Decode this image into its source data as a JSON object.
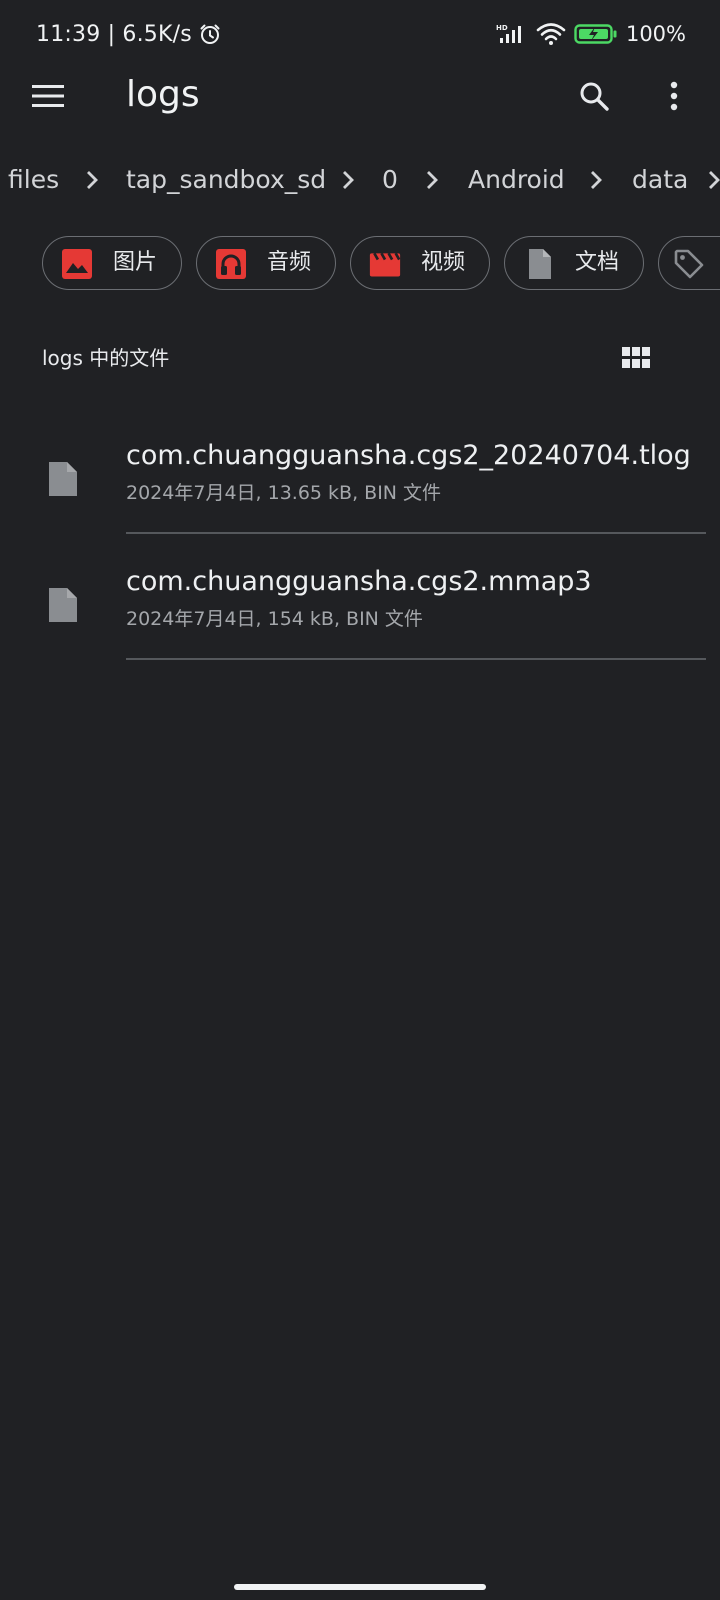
{
  "status_bar": {
    "time_speed": "11:39 | 6.5K/s",
    "battery": "100%",
    "icons": [
      "alarm-icon",
      "hd-signal-icon",
      "wifi-icon",
      "battery-charging-icon"
    ],
    "battery_color": "#4cd964"
  },
  "app_bar": {
    "title": "logs",
    "icons": [
      "menu-icon",
      "search-icon",
      "more-vert-icon"
    ]
  },
  "breadcrumb": {
    "items": [
      "files",
      "tap_sandbox_sd",
      "0",
      "Android",
      "data"
    ]
  },
  "chips": [
    {
      "label": "图片",
      "icon": "image-icon",
      "color": "#e53935"
    },
    {
      "label": "音频",
      "icon": "headphones-icon",
      "color": "#e53935"
    },
    {
      "label": "视频",
      "icon": "movie-icon",
      "color": "#e53935"
    },
    {
      "label": "文档",
      "icon": "document-icon",
      "color": "#8a8d91"
    },
    {
      "label": "",
      "icon": "tag-icon",
      "color": "#8a8d91"
    }
  ],
  "section": {
    "title": "logs 中的文件",
    "view_toggle_icon": "grid-view-icon"
  },
  "files": [
    {
      "name": "com.chuangguansha.cgs2_20240704.tlog",
      "meta": "2024年7月4日, 13.65 kB, BIN 文件",
      "icon": "file-icon"
    },
    {
      "name": "com.chuangguansha.cgs2.mmap3",
      "meta": "2024年7月4日, 154 kB, BIN 文件",
      "icon": "file-icon"
    }
  ],
  "theme": {
    "background": "#202124",
    "accent_red": "#e53935"
  }
}
